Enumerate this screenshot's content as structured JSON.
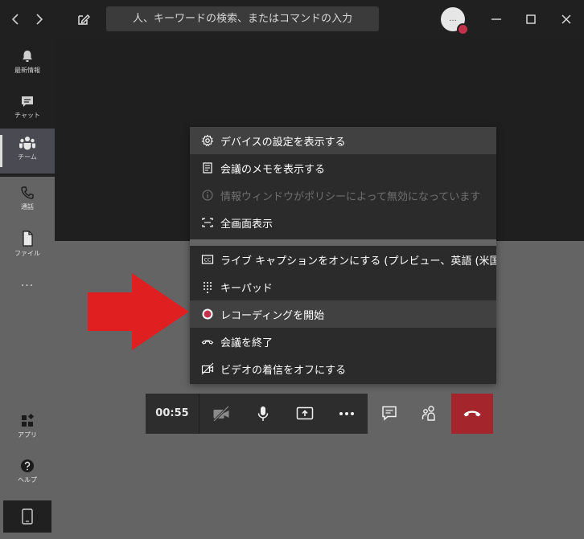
{
  "search": {
    "text": "人、キーワードの検索、またはコマンドの入力"
  },
  "avatar": {
    "initials": "..."
  },
  "rail": {
    "items": [
      {
        "id": "activity",
        "label": "最新情報",
        "icon": "bell-icon"
      },
      {
        "id": "chat",
        "label": "チャット",
        "icon": "chat-icon"
      },
      {
        "id": "teams",
        "label": "チーム",
        "icon": "teams-icon"
      },
      {
        "id": "calls",
        "label": "通話",
        "icon": "phone-icon"
      },
      {
        "id": "files",
        "label": "ファイル",
        "icon": "file-icon"
      },
      {
        "id": "more",
        "label": "...",
        "icon": "more-icon"
      }
    ],
    "bottom": [
      {
        "id": "apps",
        "label": "アプリ",
        "icon": "apps-icon"
      },
      {
        "id": "help",
        "label": "ヘルプ",
        "icon": "help-icon"
      }
    ]
  },
  "menu": {
    "items": [
      {
        "label": "デバイスの設定を表示する",
        "icon": "gear-icon",
        "state": "hover"
      },
      {
        "label": "会議のメモを表示する",
        "icon": "notes-icon",
        "state": "normal"
      },
      {
        "label": "情報ウィンドウがポリシーによって無効になっています",
        "icon": "info-icon",
        "state": "disabled"
      },
      {
        "label": "全画面表示",
        "icon": "fullscreen-icon",
        "state": "normal"
      },
      {
        "label": "ライブ キャプションをオンにする (プレビュー、英語 (米国) のみ)",
        "icon": "cc-icon",
        "state": "normal"
      },
      {
        "label": "キーパッド",
        "icon": "keypad-icon",
        "state": "normal"
      },
      {
        "label": "レコーディングを開始",
        "icon": "record-icon",
        "state": "hover"
      },
      {
        "label": "会議を終了",
        "icon": "end-call-icon",
        "state": "normal"
      },
      {
        "label": "ビデオの着信をオフにする",
        "icon": "video-off-icon",
        "state": "normal"
      }
    ]
  },
  "toolbar": {
    "timer": "00:55"
  },
  "colors": {
    "titlebar": "#202020",
    "stage": "#646464",
    "menu": "#2b2b2b",
    "hangup": "#a4262c",
    "record": "#c4314b",
    "arrow": "#e02020"
  }
}
